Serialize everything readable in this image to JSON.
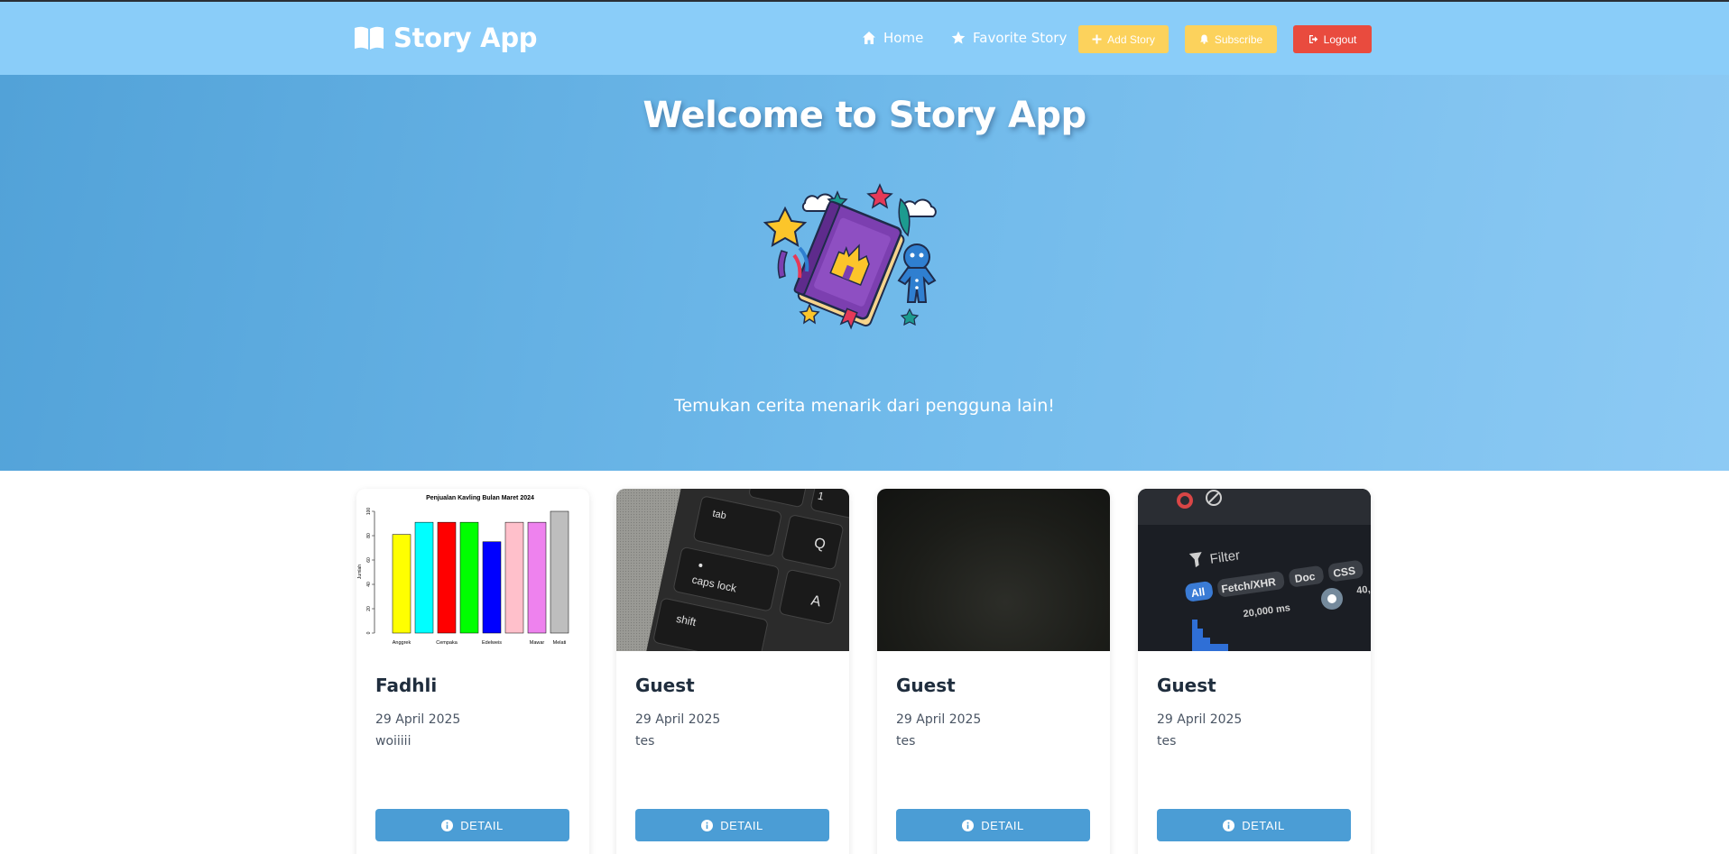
{
  "navbar": {
    "brand": "Story App",
    "links": [
      {
        "label": "Home",
        "icon": "home-icon"
      },
      {
        "label": "Favorite Story",
        "icon": "star-icon"
      }
    ],
    "buttons": {
      "add_story": "Add Story",
      "subscribe": "Subscribe",
      "logout": "Logout"
    }
  },
  "hero": {
    "title": "Welcome to Story App",
    "subtitle": "Temukan cerita menarik dari pengguna lain!"
  },
  "stories": [
    {
      "name": "Fadhli",
      "date": "29 April 2025",
      "description": "woiiiii",
      "button": "DETAIL"
    },
    {
      "name": "Guest",
      "date": "29 April 2025",
      "description": "tes",
      "button": "DETAIL"
    },
    {
      "name": "Guest",
      "date": "29 April 2025",
      "description": "tes",
      "button": "DETAIL"
    },
    {
      "name": "Guest",
      "date": "29 April 2025",
      "description": "tes",
      "button": "DETAIL"
    }
  ],
  "thumb_chart": {
    "title": "Penjualan Kavling Bulan Maret 2024",
    "ylabel": "Jumlah",
    "yticks": [
      "0",
      "20",
      "40",
      "60",
      "80",
      "100"
    ],
    "xlabels": [
      "Anggrek",
      "Cempaka",
      "Edelweis",
      "Mawar",
      "Melati"
    ],
    "values": [
      81,
      91,
      91,
      91,
      75,
      91,
      91,
      100
    ],
    "colors": [
      "#ffff00",
      "#00ffff",
      "#ff0000",
      "#00ff00",
      "#0000ff",
      "#ffc0cb",
      "#ee82ee",
      "#bebebe"
    ]
  },
  "thumb_keyboard": {
    "keys": [
      "1",
      "tab",
      "Q",
      "caps lock",
      "A",
      "shift"
    ]
  },
  "thumb_devtools": {
    "filter": "Filter",
    "tabs": [
      "All",
      "Fetch/XHR",
      "Doc",
      "CSS"
    ],
    "timing": "20,000 ms",
    "timing_right": "40,"
  },
  "colors": {
    "navbar": "#8acdf9",
    "hero_start": "#52a2d8",
    "hero_end": "#8dcaf4",
    "accent_yellow": "#fcd25c",
    "logout_red": "#e94b3e",
    "detail_blue": "#4b9dd5"
  }
}
